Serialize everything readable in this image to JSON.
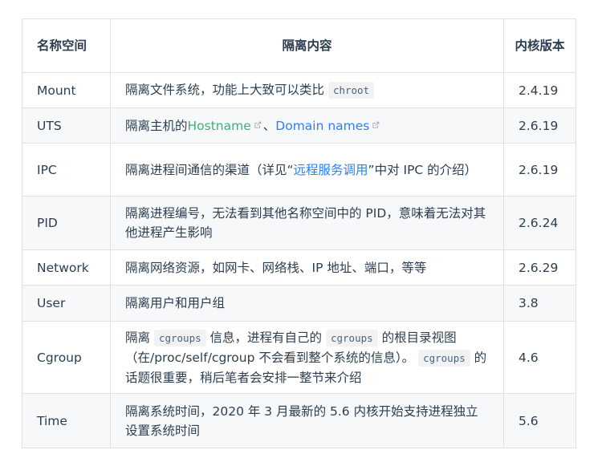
{
  "headers": {
    "name": "名称空间",
    "desc": "隔离内容",
    "version": "内核版本"
  },
  "rows": [
    {
      "name": "Mount",
      "desc_before": "隔离文件系统，功能上大致可以类比 ",
      "code1": "chroot",
      "version": "2.4.19"
    },
    {
      "name": "UTS",
      "desc_before": "隔离主机的",
      "link1": "Hostname",
      "sep": "、",
      "link2": "Domain names",
      "version": "2.6.19"
    },
    {
      "name": "IPC",
      "desc_before": "隔离进程间通信的渠道（详见“",
      "link1": "远程服务调用",
      "desc_after": "”中对 IPC 的介绍）",
      "version": "2.6.19"
    },
    {
      "name": "PID",
      "desc": "隔离进程编号，无法看到其他名称空间中的 PID，意味着无法对其他进程产生影响",
      "version": "2.6.24"
    },
    {
      "name": "Network",
      "desc": "隔离网络资源，如网卡、网络栈、IP 地址、端口，等等",
      "version": "2.6.29"
    },
    {
      "name": "User",
      "desc": "隔离用户和用户组",
      "version": "3.8"
    },
    {
      "name": "Cgroup",
      "desc_part1": "隔离 ",
      "code1": "cgroups",
      "desc_part2": " 信息，进程有自己的 ",
      "code2": "cgroups",
      "desc_part3": " 的根目录视图（在/proc/self/cgroup 不会看到整个系统的信息）。 ",
      "code3": "cgroups",
      "desc_part4": " 的话题很重要，稍后笔者会安排一整节来介绍",
      "version": "4.6"
    },
    {
      "name": "Time",
      "desc": "隔离系统时间，2020 年 3 月最新的 5.6 内核开始支持进程独立设置系统时间",
      "version": "5.6"
    }
  ],
  "colors": {
    "link": "#3eaf7c",
    "link_blue": "#2f80ed",
    "border": "#dfe2e5",
    "stripe": "#f6f8fa",
    "text": "#2c3e50"
  },
  "icons": {
    "external": "external-link-icon"
  }
}
